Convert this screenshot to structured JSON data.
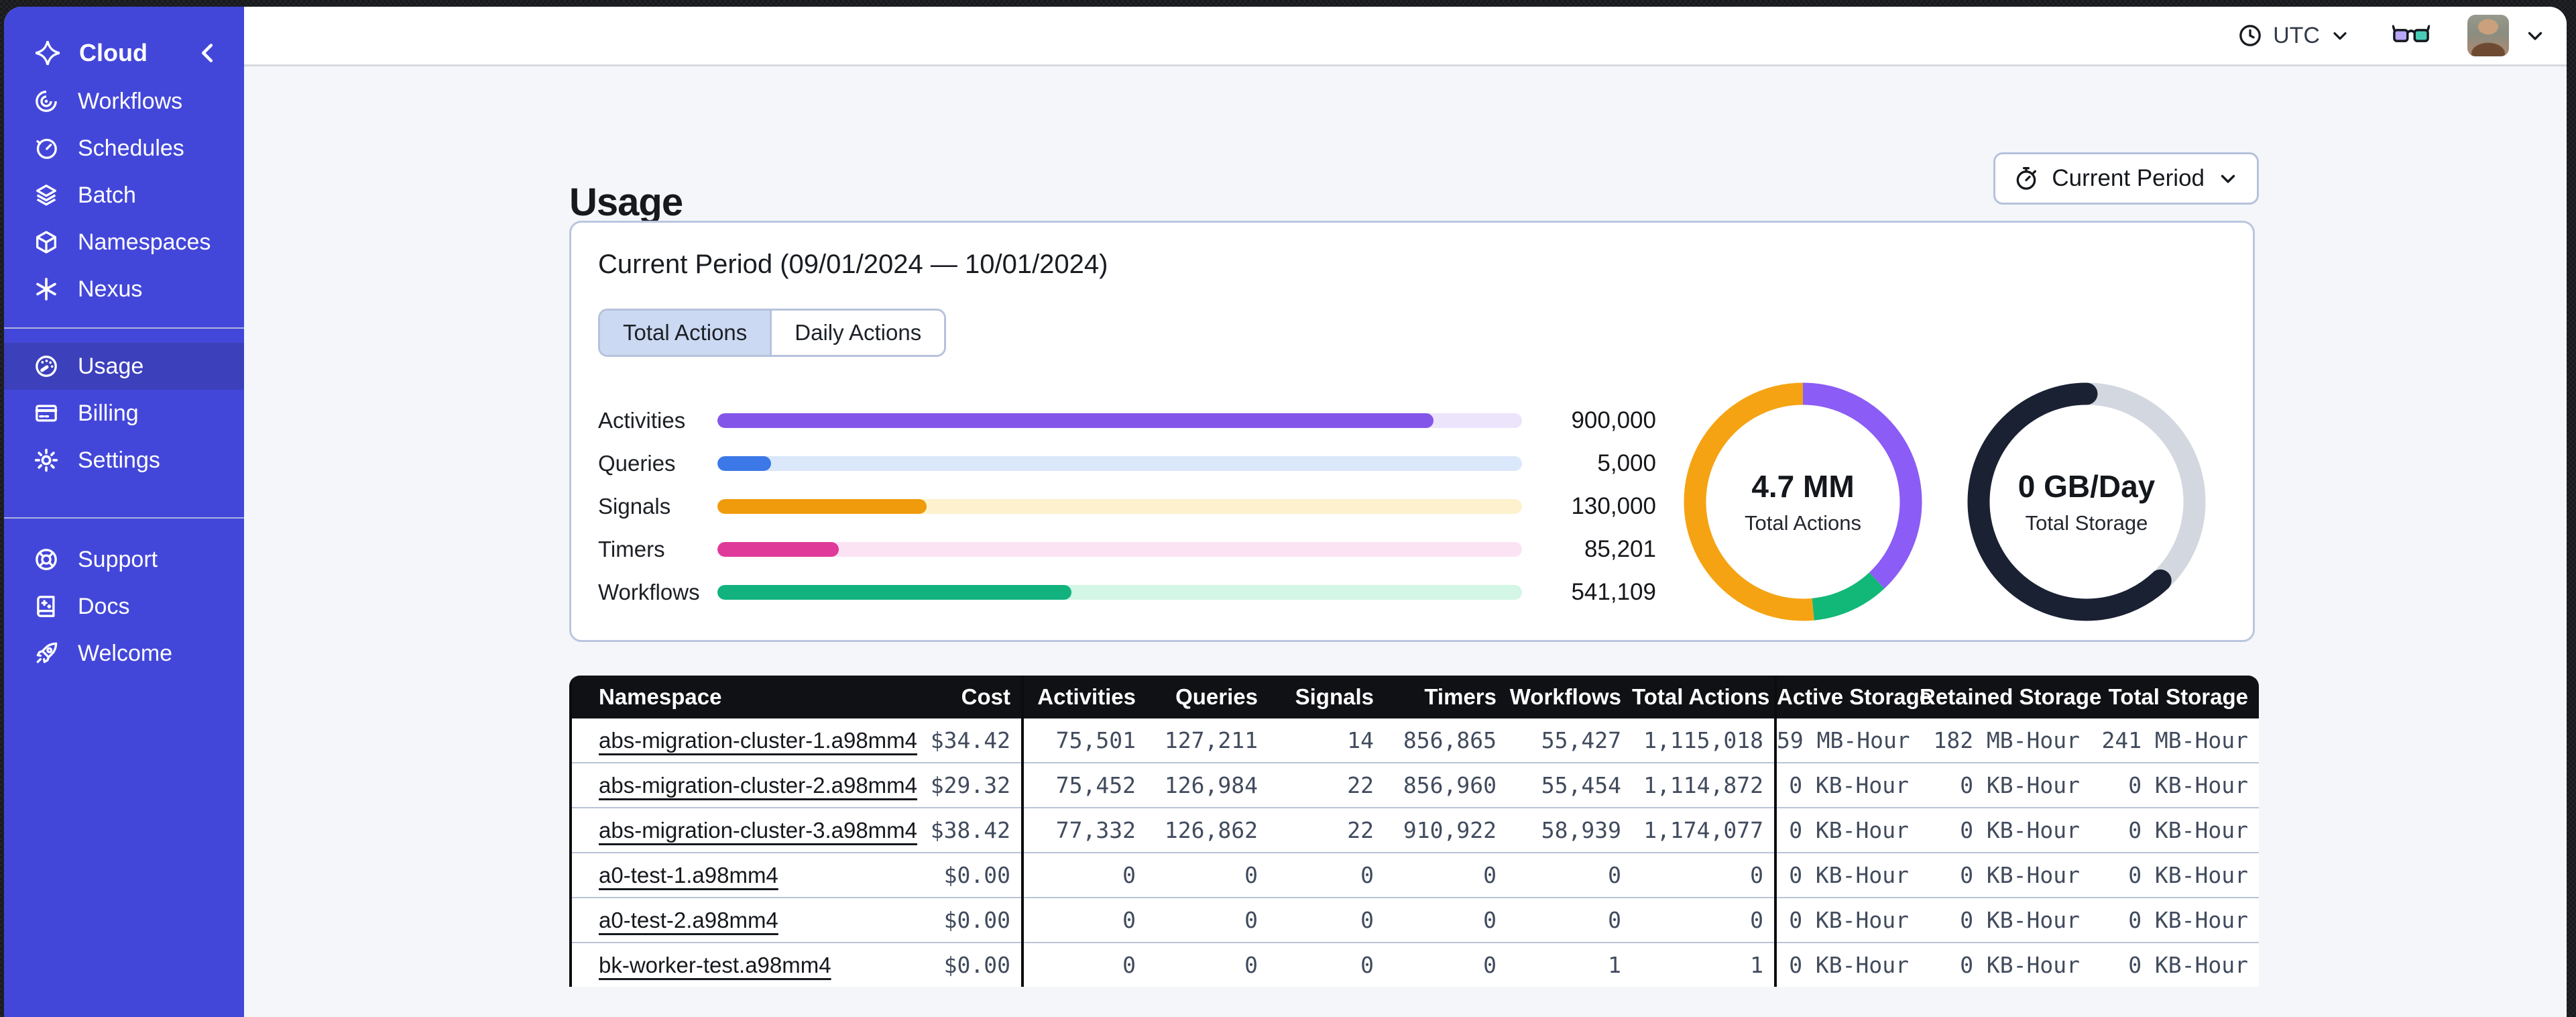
{
  "topbar": {
    "timezone": "UTC"
  },
  "sidebar": {
    "brand_label": "Cloud",
    "accent_color": "#4347d9",
    "active_color": "#3c40bb",
    "primary": [
      {
        "label": "Workflows",
        "icon": "workflows-icon"
      },
      {
        "label": "Schedules",
        "icon": "schedules-icon"
      },
      {
        "label": "Batch",
        "icon": "batch-icon"
      },
      {
        "label": "Namespaces",
        "icon": "namespaces-icon"
      },
      {
        "label": "Nexus",
        "icon": "nexus-icon"
      }
    ],
    "account": [
      {
        "label": "Usage",
        "icon": "usage-icon",
        "active": true
      },
      {
        "label": "Billing",
        "icon": "billing-icon"
      },
      {
        "label": "Settings",
        "icon": "settings-icon"
      }
    ],
    "footer": [
      {
        "label": "Support",
        "icon": "support-icon"
      },
      {
        "label": "Docs",
        "icon": "docs-icon"
      },
      {
        "label": "Welcome",
        "icon": "welcome-icon"
      }
    ]
  },
  "page": {
    "title": "Usage",
    "period_selector_label": "Current Period"
  },
  "card": {
    "title": "Current Period (09/01/2024 — 10/01/2024)",
    "tabs": [
      {
        "label": "Total Actions",
        "active": true
      },
      {
        "label": "Daily Actions",
        "active": false
      }
    ]
  },
  "chart_data": [
    {
      "type": "bar",
      "title": "Actions by type (current period)",
      "orientation": "horizontal",
      "categories": [
        "Activities",
        "Queries",
        "Signals",
        "Timers",
        "Workflows"
      ],
      "values": [
        900000,
        5000,
        130000,
        85201,
        541109
      ],
      "value_labels": [
        "900,000",
        "5,000",
        "130,000",
        "85,201",
        "541,109"
      ],
      "fill_percent": [
        89,
        6.7,
        26,
        15.1,
        44
      ],
      "colors": [
        "#8455e9",
        "#3c78e8",
        "#f09b0b",
        "#df3a9a",
        "#11b27d"
      ],
      "track_colors": [
        "#ece4fb",
        "#dbe8fb",
        "#fdf2cd",
        "#fce3f4",
        "#d3f6e6"
      ]
    },
    {
      "type": "pie",
      "subtype": "donut",
      "center_value": "4.7 MM",
      "center_label": "Total Actions",
      "slices": [
        {
          "name": "activities",
          "percent": 38,
          "color": "#8b5cf6"
        },
        {
          "name": "workflows",
          "percent": 10.5,
          "color": "#12b877"
        },
        {
          "name": "other",
          "percent": 51.5,
          "color": "#f5a313"
        }
      ]
    },
    {
      "type": "pie",
      "subtype": "donut",
      "center_value": "0 GB/Day",
      "center_label": "Total Storage",
      "slices": [
        {
          "name": "free",
          "percent": 38,
          "color": "#d3d7df"
        },
        {
          "name": "used",
          "percent": 62,
          "color": "#1a2133",
          "cap": "round"
        }
      ]
    }
  ],
  "table": {
    "columns": [
      {
        "label": "Namespace",
        "group_end": false
      },
      {
        "label": "Cost",
        "group_end": true
      },
      {
        "label": "Activities",
        "group_end": false
      },
      {
        "label": "Queries",
        "group_end": false
      },
      {
        "label": "Signals",
        "group_end": false
      },
      {
        "label": "Timers",
        "group_end": false
      },
      {
        "label": "Workflows",
        "group_end": false
      },
      {
        "label": "Total Actions",
        "group_end": true
      },
      {
        "label": "Active Storage",
        "group_end": false
      },
      {
        "label": "Retained Storage",
        "group_end": false
      },
      {
        "label": "Total Storage",
        "group_end": false
      }
    ],
    "rows": [
      [
        "abs-migration-cluster-1.a98mm4",
        "$34.42",
        "75,501",
        "127,211",
        "14",
        "856,865",
        "55,427",
        "1,115,018",
        "59 MB-Hour",
        "182 MB-Hour",
        "241 MB-Hour"
      ],
      [
        "abs-migration-cluster-2.a98mm4",
        "$29.32",
        "75,452",
        "126,984",
        "22",
        "856,960",
        "55,454",
        "1,114,872",
        "0 KB-Hour",
        "0 KB-Hour",
        "0 KB-Hour"
      ],
      [
        "abs-migration-cluster-3.a98mm4",
        "$38.42",
        "77,332",
        "126,862",
        "22",
        "910,922",
        "58,939",
        "1,174,077",
        "0 KB-Hour",
        "0 KB-Hour",
        "0 KB-Hour"
      ],
      [
        "a0-test-1.a98mm4",
        "$0.00",
        "0",
        "0",
        "0",
        "0",
        "0",
        "0",
        "0 KB-Hour",
        "0 KB-Hour",
        "0 KB-Hour"
      ],
      [
        "a0-test-2.a98mm4",
        "$0.00",
        "0",
        "0",
        "0",
        "0",
        "0",
        "0",
        "0 KB-Hour",
        "0 KB-Hour",
        "0 KB-Hour"
      ],
      [
        "bk-worker-test.a98mm4",
        "$0.00",
        "0",
        "0",
        "0",
        "0",
        "1",
        "1",
        "0 KB-Hour",
        "0 KB-Hour",
        "0 KB-Hour"
      ]
    ]
  }
}
